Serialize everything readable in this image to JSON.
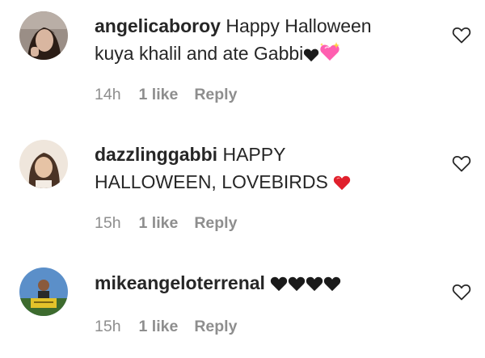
{
  "comments": [
    {
      "username": "angelicaboroy",
      "text_line1": "Happy Halloween",
      "text_line2": "kuya khalil and ate Gabbi",
      "emojis": [
        "black-heart",
        "sparkling-heart"
      ],
      "time": "14h",
      "likes": "1 like",
      "reply": "Reply",
      "avatar_colors": {
        "bg": "#9a8e86",
        "face": "#d9b6a0",
        "hair": "#2b1d16"
      }
    },
    {
      "username": "dazzlinggabbi",
      "text_line1": "HAPPY",
      "text_line2": "HALLOWEEN, LOVEBIRDS",
      "emojis": [
        "red-heart"
      ],
      "time": "15h",
      "likes": "1 like",
      "reply": "Reply",
      "avatar_colors": {
        "bg": "#efe6dc",
        "face": "#e6c3a5",
        "hair": "#4a3325"
      }
    },
    {
      "username": "mikeangeloterrenal",
      "text_line1": "",
      "text_line2": "",
      "emojis": [
        "black-heart",
        "black-heart",
        "black-heart",
        "black-heart"
      ],
      "time": "15h",
      "likes": "1 like",
      "reply": "Reply",
      "avatar_colors": {
        "sky": "#5b8fc9",
        "ground": "#3d6b2e",
        "sign": "#e3c22a"
      }
    }
  ],
  "colors": {
    "text": "#262626",
    "meta": "#8e8e8e",
    "red_heart": "#e0202c",
    "sparkle_heart": "#ff5fb0"
  }
}
